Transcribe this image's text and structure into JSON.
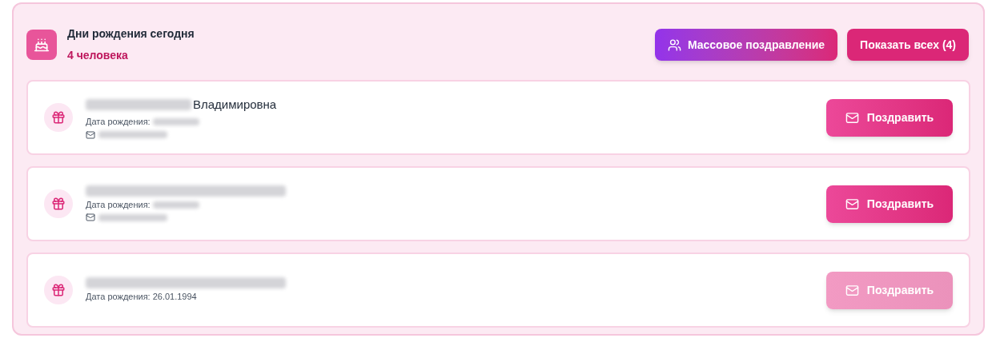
{
  "header": {
    "title": "Дни рождения сегодня",
    "count": "4 человека"
  },
  "actions": [
    {
      "kind": "mass",
      "label": "Массовое поздравление"
    },
    {
      "kind": "all",
      "label": "Показать всех (4)"
    }
  ],
  "people": [
    {
      "name_redacted": true,
      "name_visible": "Владимировна",
      "birth_label": "Дата рождения:",
      "birth_date_redacted": true,
      "email_redacted": true,
      "button": "Поздравить",
      "disabled": false
    },
    {
      "name_redacted": true,
      "birth_label": "Дата рождения:",
      "birth_date_redacted": true,
      "email_redacted": true,
      "button": "Поздравить",
      "disabled": false
    },
    {
      "name_redacted": true,
      "birth_label": "Дата рождения:",
      "birth_date": "26.01.1994",
      "button": "Поздравить",
      "disabled": true
    }
  ]
}
